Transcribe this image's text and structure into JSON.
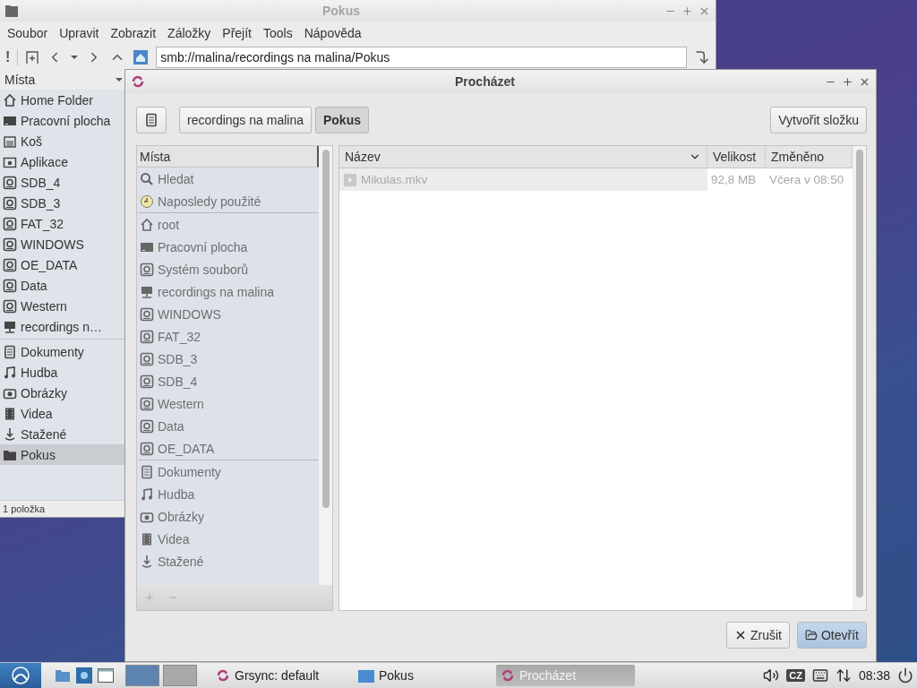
{
  "file_manager": {
    "title": "Pokus",
    "menu": [
      "Soubor",
      "Upravit",
      "Zobrazit",
      "Záložky",
      "Přejít",
      "Tools",
      "Nápověda"
    ],
    "toolbar_label": "!",
    "address": "smb://malina/recordings na malina/Pokus",
    "sidebar_header": "Místa",
    "place_groups": [
      [
        {
          "label": "Home Folder",
          "kind": "home",
          "selected": false
        },
        {
          "label": "Pracovní plocha",
          "kind": "desktop",
          "selected": false
        },
        {
          "label": "Koš",
          "kind": "trash",
          "selected": false
        },
        {
          "label": "Aplikace",
          "kind": "apps",
          "selected": false
        },
        {
          "label": "SDB_4",
          "kind": "drive",
          "selected": false
        },
        {
          "label": "SDB_3",
          "kind": "drive",
          "selected": false
        },
        {
          "label": "FAT_32",
          "kind": "drive",
          "selected": false
        },
        {
          "label": "WINDOWS",
          "kind": "drive",
          "selected": false
        },
        {
          "label": "OE_DATA",
          "kind": "drive",
          "selected": false
        },
        {
          "label": "Data",
          "kind": "drive",
          "selected": false
        },
        {
          "label": "Western",
          "kind": "drive",
          "selected": false
        },
        {
          "label": "recordings n…",
          "kind": "network",
          "selected": false
        }
      ],
      [
        {
          "label": "Dokumenty",
          "kind": "docs",
          "selected": false
        },
        {
          "label": "Hudba",
          "kind": "music",
          "selected": false
        },
        {
          "label": "Obrázky",
          "kind": "pictures",
          "selected": false
        },
        {
          "label": "Videa",
          "kind": "video",
          "selected": false
        },
        {
          "label": "Stažené",
          "kind": "download",
          "selected": false
        },
        {
          "label": "Pokus",
          "kind": "folder",
          "selected": true
        }
      ]
    ],
    "status": "1 položka"
  },
  "dialog": {
    "title": "Procházet",
    "path": [
      {
        "label": "recordings na malina",
        "selected": false
      },
      {
        "label": "Pokus",
        "selected": true
      }
    ],
    "create_folder": "Vytvořit složku",
    "places_header": "Místa",
    "place_groups": [
      [
        {
          "label": "Hledat",
          "kind": "search"
        },
        {
          "label": "Naposledy použité",
          "kind": "recent"
        }
      ],
      [
        {
          "label": "root",
          "kind": "home"
        },
        {
          "label": "Pracovní plocha",
          "kind": "desktop"
        },
        {
          "label": "Systém souborů",
          "kind": "drive"
        },
        {
          "label": "recordings na malina",
          "kind": "network"
        },
        {
          "label": "WINDOWS",
          "kind": "drive"
        },
        {
          "label": "FAT_32",
          "kind": "drive"
        },
        {
          "label": "SDB_3",
          "kind": "drive"
        },
        {
          "label": "SDB_4",
          "kind": "drive"
        },
        {
          "label": "Western",
          "kind": "drive"
        },
        {
          "label": "Data",
          "kind": "drive"
        },
        {
          "label": "OE_DATA",
          "kind": "drive"
        }
      ],
      [
        {
          "label": "Dokumenty",
          "kind": "docs"
        },
        {
          "label": "Hudba",
          "kind": "music"
        },
        {
          "label": "Obrázky",
          "kind": "pictures"
        },
        {
          "label": "Videa",
          "kind": "video"
        },
        {
          "label": "Stažené",
          "kind": "download"
        }
      ]
    ],
    "columns": [
      "Název",
      "Velikost",
      "Změněno"
    ],
    "rows": [
      {
        "name": "Mikulas.mkv",
        "size": "92,8 MB",
        "modified": "Včera v 08:50",
        "disabled": true
      }
    ],
    "buttons": [
      {
        "label": "Zrušit",
        "kind": "cancel",
        "default": false
      },
      {
        "label": "Otevřít",
        "kind": "open",
        "default": true
      }
    ]
  },
  "taskbar": {
    "pager": [
      {
        "selected": true
      },
      {
        "selected": false
      }
    ],
    "tasks": [
      {
        "label": "Grsync: default",
        "kind": "sync",
        "selected": false
      },
      {
        "label": "Pokus",
        "kind": "folder",
        "selected": false
      },
      {
        "label": "Procházet",
        "kind": "sync",
        "selected": true
      }
    ],
    "keyboard_layout": "CZ",
    "clock": "08:38"
  }
}
